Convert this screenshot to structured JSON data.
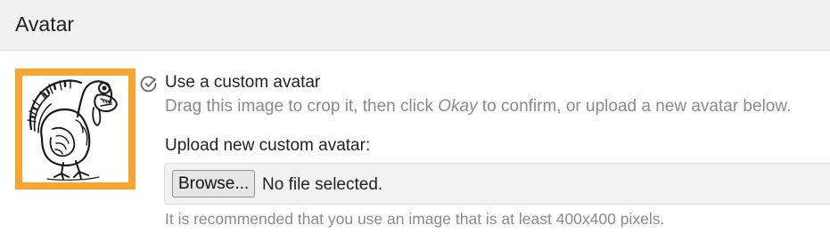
{
  "section": {
    "title": "Avatar"
  },
  "avatar": {
    "image_icon": "turkey-drawing",
    "frame_color": "#f7a52c"
  },
  "custom_option": {
    "icon": "check-circle-icon",
    "label": "Use a custom avatar",
    "help_prefix": "Drag this image to crop it, then click ",
    "help_emphasis": "Okay",
    "help_suffix": " to confirm, or upload a new avatar below."
  },
  "upload": {
    "label": "Upload new custom avatar:",
    "browse_label": "Browse...",
    "file_status": "No file selected.",
    "recommendation": "It is recommended that you use an image that is at least 400x400 pixels."
  }
}
